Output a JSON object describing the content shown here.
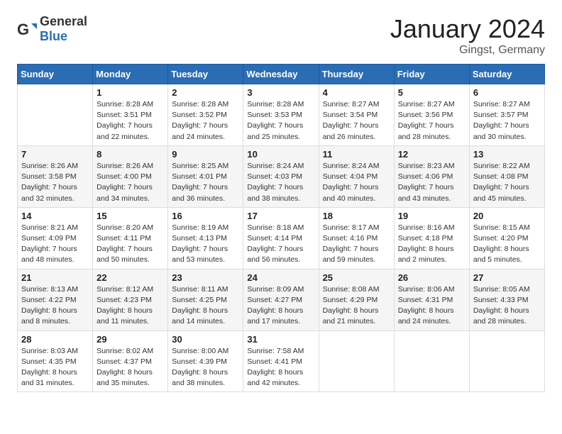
{
  "header": {
    "logo_general": "General",
    "logo_blue": "Blue",
    "month_title": "January 2024",
    "location": "Gingst, Germany"
  },
  "weekdays": [
    "Sunday",
    "Monday",
    "Tuesday",
    "Wednesday",
    "Thursday",
    "Friday",
    "Saturday"
  ],
  "weeks": [
    [
      {
        "day": "",
        "info": ""
      },
      {
        "day": "1",
        "info": "Sunrise: 8:28 AM\nSunset: 3:51 PM\nDaylight: 7 hours\nand 22 minutes."
      },
      {
        "day": "2",
        "info": "Sunrise: 8:28 AM\nSunset: 3:52 PM\nDaylight: 7 hours\nand 24 minutes."
      },
      {
        "day": "3",
        "info": "Sunrise: 8:28 AM\nSunset: 3:53 PM\nDaylight: 7 hours\nand 25 minutes."
      },
      {
        "day": "4",
        "info": "Sunrise: 8:27 AM\nSunset: 3:54 PM\nDaylight: 7 hours\nand 26 minutes."
      },
      {
        "day": "5",
        "info": "Sunrise: 8:27 AM\nSunset: 3:56 PM\nDaylight: 7 hours\nand 28 minutes."
      },
      {
        "day": "6",
        "info": "Sunrise: 8:27 AM\nSunset: 3:57 PM\nDaylight: 7 hours\nand 30 minutes."
      }
    ],
    [
      {
        "day": "7",
        "info": "Sunrise: 8:26 AM\nSunset: 3:58 PM\nDaylight: 7 hours\nand 32 minutes."
      },
      {
        "day": "8",
        "info": "Sunrise: 8:26 AM\nSunset: 4:00 PM\nDaylight: 7 hours\nand 34 minutes."
      },
      {
        "day": "9",
        "info": "Sunrise: 8:25 AM\nSunset: 4:01 PM\nDaylight: 7 hours\nand 36 minutes."
      },
      {
        "day": "10",
        "info": "Sunrise: 8:24 AM\nSunset: 4:03 PM\nDaylight: 7 hours\nand 38 minutes."
      },
      {
        "day": "11",
        "info": "Sunrise: 8:24 AM\nSunset: 4:04 PM\nDaylight: 7 hours\nand 40 minutes."
      },
      {
        "day": "12",
        "info": "Sunrise: 8:23 AM\nSunset: 4:06 PM\nDaylight: 7 hours\nand 43 minutes."
      },
      {
        "day": "13",
        "info": "Sunrise: 8:22 AM\nSunset: 4:08 PM\nDaylight: 7 hours\nand 45 minutes."
      }
    ],
    [
      {
        "day": "14",
        "info": "Sunrise: 8:21 AM\nSunset: 4:09 PM\nDaylight: 7 hours\nand 48 minutes."
      },
      {
        "day": "15",
        "info": "Sunrise: 8:20 AM\nSunset: 4:11 PM\nDaylight: 7 hours\nand 50 minutes."
      },
      {
        "day": "16",
        "info": "Sunrise: 8:19 AM\nSunset: 4:13 PM\nDaylight: 7 hours\nand 53 minutes."
      },
      {
        "day": "17",
        "info": "Sunrise: 8:18 AM\nSunset: 4:14 PM\nDaylight: 7 hours\nand 56 minutes."
      },
      {
        "day": "18",
        "info": "Sunrise: 8:17 AM\nSunset: 4:16 PM\nDaylight: 7 hours\nand 59 minutes."
      },
      {
        "day": "19",
        "info": "Sunrise: 8:16 AM\nSunset: 4:18 PM\nDaylight: 8 hours\nand 2 minutes."
      },
      {
        "day": "20",
        "info": "Sunrise: 8:15 AM\nSunset: 4:20 PM\nDaylight: 8 hours\nand 5 minutes."
      }
    ],
    [
      {
        "day": "21",
        "info": "Sunrise: 8:13 AM\nSunset: 4:22 PM\nDaylight: 8 hours\nand 8 minutes."
      },
      {
        "day": "22",
        "info": "Sunrise: 8:12 AM\nSunset: 4:23 PM\nDaylight: 8 hours\nand 11 minutes."
      },
      {
        "day": "23",
        "info": "Sunrise: 8:11 AM\nSunset: 4:25 PM\nDaylight: 8 hours\nand 14 minutes."
      },
      {
        "day": "24",
        "info": "Sunrise: 8:09 AM\nSunset: 4:27 PM\nDaylight: 8 hours\nand 17 minutes."
      },
      {
        "day": "25",
        "info": "Sunrise: 8:08 AM\nSunset: 4:29 PM\nDaylight: 8 hours\nand 21 minutes."
      },
      {
        "day": "26",
        "info": "Sunrise: 8:06 AM\nSunset: 4:31 PM\nDaylight: 8 hours\nand 24 minutes."
      },
      {
        "day": "27",
        "info": "Sunrise: 8:05 AM\nSunset: 4:33 PM\nDaylight: 8 hours\nand 28 minutes."
      }
    ],
    [
      {
        "day": "28",
        "info": "Sunrise: 8:03 AM\nSunset: 4:35 PM\nDaylight: 8 hours\nand 31 minutes."
      },
      {
        "day": "29",
        "info": "Sunrise: 8:02 AM\nSunset: 4:37 PM\nDaylight: 8 hours\nand 35 minutes."
      },
      {
        "day": "30",
        "info": "Sunrise: 8:00 AM\nSunset: 4:39 PM\nDaylight: 8 hours\nand 38 minutes."
      },
      {
        "day": "31",
        "info": "Sunrise: 7:58 AM\nSunset: 4:41 PM\nDaylight: 8 hours\nand 42 minutes."
      },
      {
        "day": "",
        "info": ""
      },
      {
        "day": "",
        "info": ""
      },
      {
        "day": "",
        "info": ""
      }
    ]
  ]
}
